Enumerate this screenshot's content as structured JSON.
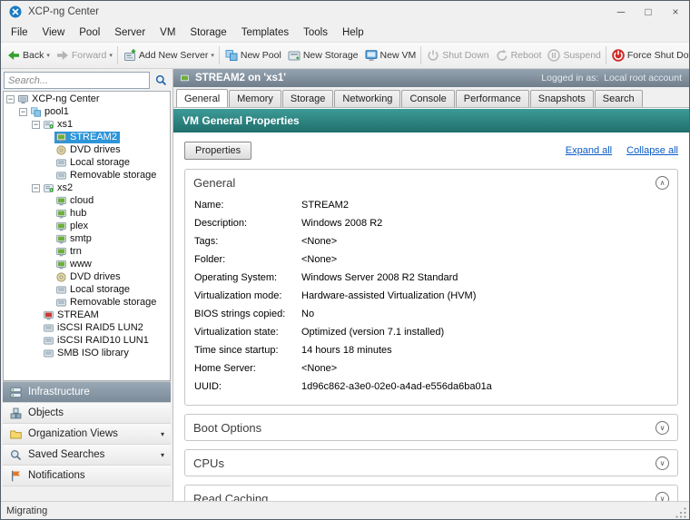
{
  "window": {
    "title": "XCP-ng Center",
    "status": "Migrating"
  },
  "colors": {
    "selection": "#2e95d8",
    "banner": "#2f8f8b",
    "force_shutdown": "#cf2a27",
    "link": "#0b5bc4"
  },
  "menu": {
    "items": [
      "File",
      "View",
      "Pool",
      "Server",
      "VM",
      "Storage",
      "Templates",
      "Tools",
      "Help"
    ]
  },
  "toolbar": {
    "buttons": [
      {
        "label": "Back",
        "icon": "back",
        "caret": true
      },
      {
        "label": "Forward",
        "icon": "forward",
        "caret": true,
        "disabled": true
      },
      {
        "sep": true
      },
      {
        "label": "Add New Server",
        "icon": "add-server",
        "caret": true
      },
      {
        "sep": true
      },
      {
        "label": "New Pool",
        "icon": "new-pool"
      },
      {
        "label": "New Storage",
        "icon": "new-storage"
      },
      {
        "label": "New VM",
        "icon": "new-vm"
      },
      {
        "sep": true
      },
      {
        "label": "Shut Down",
        "icon": "shutdown",
        "disabled": true
      },
      {
        "label": "Reboot",
        "icon": "reboot",
        "disabled": true
      },
      {
        "label": "Suspend",
        "icon": "suspend",
        "disabled": true
      },
      {
        "sep": true
      },
      {
        "label": "Force Shut Down",
        "icon": "force-shutdown"
      }
    ]
  },
  "sidebar": {
    "search": {
      "placeholder": "Search..."
    },
    "tree": [
      {
        "label": "XCP-ng Center",
        "level": 0,
        "icon": "center",
        "expander": "minus"
      },
      {
        "label": "pool1",
        "level": 1,
        "icon": "pool",
        "expander": "minus"
      },
      {
        "label": "xs1",
        "level": 2,
        "icon": "server",
        "expander": "minus"
      },
      {
        "label": "STREAM2",
        "level": 3,
        "icon": "vm-running",
        "selected": true
      },
      {
        "label": "DVD drives",
        "level": 3,
        "icon": "dvd"
      },
      {
        "label": "Local storage",
        "level": 3,
        "icon": "storage"
      },
      {
        "label": "Removable storage",
        "level": 3,
        "icon": "storage"
      },
      {
        "label": "xs2",
        "level": 2,
        "icon": "server",
        "expander": "minus"
      },
      {
        "label": "cloud",
        "level": 3,
        "icon": "vm-running"
      },
      {
        "label": "hub",
        "level": 3,
        "icon": "vm-running"
      },
      {
        "label": "plex",
        "level": 3,
        "icon": "vm-running"
      },
      {
        "label": "smtp",
        "level": 3,
        "icon": "vm-running"
      },
      {
        "label": "trn",
        "level": 3,
        "icon": "vm-running"
      },
      {
        "label": "www",
        "level": 3,
        "icon": "vm-running"
      },
      {
        "label": "DVD drives",
        "level": 3,
        "icon": "dvd"
      },
      {
        "label": "Local storage",
        "level": 3,
        "icon": "storage"
      },
      {
        "label": "Removable storage",
        "level": 3,
        "icon": "storage"
      },
      {
        "label": "STREAM",
        "level": 2,
        "icon": "vm-stopped"
      },
      {
        "label": "iSCSI RAID5 LUN2",
        "level": 2,
        "icon": "storage"
      },
      {
        "label": "iSCSI RAID10 LUN1",
        "level": 2,
        "icon": "storage"
      },
      {
        "label": "SMB ISO library",
        "level": 2,
        "icon": "storage"
      }
    ],
    "nav": [
      {
        "label": "Infrastructure",
        "icon": "infrastructure",
        "selected": true
      },
      {
        "label": "Objects",
        "icon": "objects"
      },
      {
        "label": "Organization Views",
        "icon": "org-views",
        "caret": true
      },
      {
        "label": "Saved Searches",
        "icon": "saved-searches",
        "caret": true
      },
      {
        "label": "Notifications",
        "icon": "notifications"
      }
    ]
  },
  "main": {
    "header": {
      "title": "STREAM2 on 'xs1'",
      "logged_in": "Logged in as:  Local root account"
    },
    "tabs": [
      {
        "label": "General",
        "active": true
      },
      {
        "label": "Memory"
      },
      {
        "label": "Storage"
      },
      {
        "label": "Networking"
      },
      {
        "label": "Console"
      },
      {
        "label": "Performance"
      },
      {
        "label": "Snapshots"
      },
      {
        "label": "Search"
      }
    ],
    "banner": "VM General Properties",
    "properties_button": "Properties",
    "expand_all": "Expand all",
    "collapse_all": "Collapse all",
    "sections": [
      {
        "title": "General",
        "expanded": true,
        "rows": [
          {
            "label": "Name:",
            "value": "STREAM2"
          },
          {
            "label": "Description:",
            "value": "Windows 2008 R2"
          },
          {
            "label": "Tags:",
            "value": "<None>"
          },
          {
            "label": "Folder:",
            "value": "<None>"
          },
          {
            "label": "Operating System:",
            "value": "Windows Server 2008 R2 Standard"
          },
          {
            "label": "Virtualization mode:",
            "value": "Hardware-assisted Virtualization (HVM)"
          },
          {
            "label": "BIOS strings copied:",
            "value": "No"
          },
          {
            "label": "Virtualization state:",
            "value": "Optimized (version 7.1 installed)"
          },
          {
            "label": "Time since startup:",
            "value": "14 hours 18 minutes"
          },
          {
            "label": "Home Server:",
            "value": "<None>"
          },
          {
            "label": "UUID:",
            "value": "1d96c862-a3e0-02e0-a4ad-e556da6ba01a"
          }
        ]
      },
      {
        "title": "Boot Options",
        "expanded": false
      },
      {
        "title": "CPUs",
        "expanded": false
      },
      {
        "title": "Read Caching",
        "expanded": false
      }
    ]
  }
}
